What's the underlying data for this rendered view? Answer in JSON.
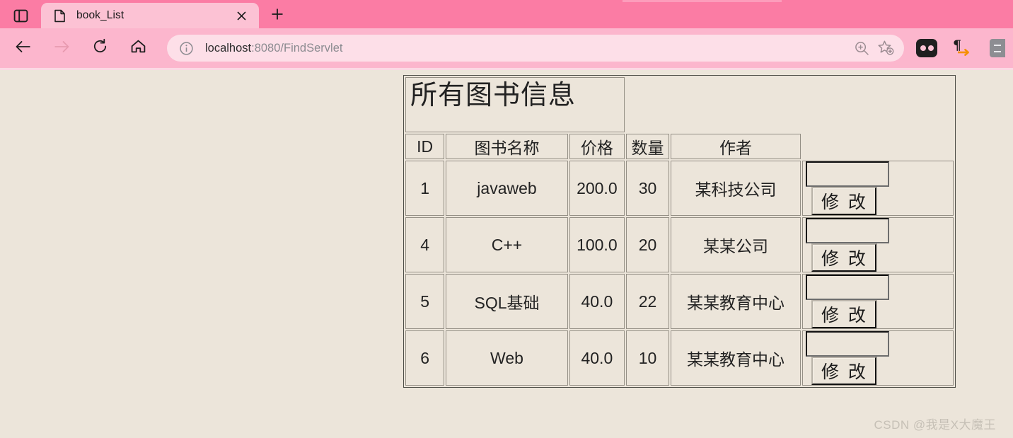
{
  "browser": {
    "tab_search_icon": "split-panel-icon",
    "tab": {
      "favicon": "document-icon",
      "title": "book_List",
      "close_icon": "close-icon"
    },
    "new_tab_icon": "plus-icon",
    "nav": {
      "back_icon": "back-arrow-icon",
      "forward_icon": "forward-arrow-icon",
      "reload_icon": "reload-icon",
      "home_icon": "home-icon"
    },
    "omnibox": {
      "info_icon": "info-circle-icon",
      "url_host": "localhost",
      "url_path": ":8080/FindServlet",
      "url_full": "localhost:8080/FindServlet",
      "zoom_icon": "zoom-in-icon",
      "favorite_icon": "star-add-icon"
    },
    "toolbar_icons": [
      "collections-icon",
      "reading-aloud-pilcrow-icon",
      "sidebar-icon"
    ],
    "colors": {
      "tab_strip": "#fb7ca4",
      "active_tab": "#fcc2d4",
      "toolbar": "#fcb6cd",
      "omnibox": "#fddfe8"
    }
  },
  "page": {
    "background_color": "#ece5da",
    "title": "所有图书信息",
    "table": {
      "headers": [
        "ID",
        "图书名称",
        "价格",
        "数量",
        "作者"
      ],
      "rows": [
        {
          "id": "1",
          "name": "javaweb",
          "price": "200.0",
          "qty": "30",
          "author": "某科技公司",
          "input_value": "",
          "button_label": "修 改"
        },
        {
          "id": "4",
          "name": "C++",
          "price": "100.0",
          "qty": "20",
          "author": "某某公司",
          "input_value": "",
          "button_label": "修 改"
        },
        {
          "id": "5",
          "name": "SQL基础",
          "price": "40.0",
          "qty": "22",
          "author": "某某教育中心",
          "input_value": "",
          "button_label": "修 改"
        },
        {
          "id": "6",
          "name": "Web",
          "price": "40.0",
          "qty": "10",
          "author": "某某教育中心",
          "input_value": "",
          "button_label": "修 改"
        }
      ]
    },
    "watermark": "CSDN @我是X大魔王"
  }
}
